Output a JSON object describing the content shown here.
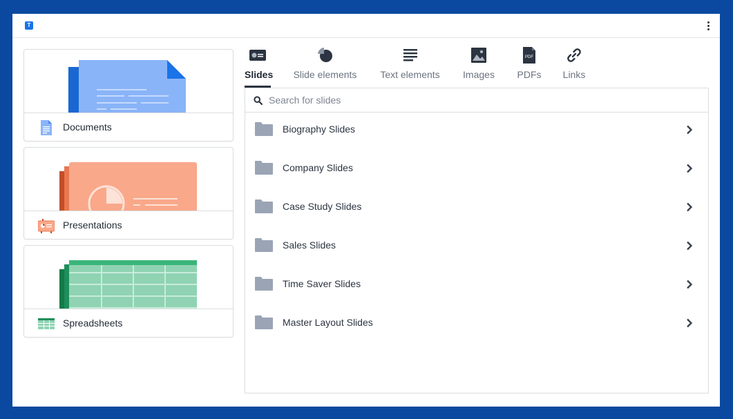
{
  "topbar": {
    "logo_letter": "T",
    "menu_icon": "more-vertical-icon"
  },
  "sidebar": {
    "cards": [
      {
        "label": "Documents",
        "icon": "docs-icon"
      },
      {
        "label": "Presentations",
        "icon": "slides-icon"
      },
      {
        "label": "Spreadsheets",
        "icon": "sheets-icon"
      }
    ]
  },
  "tabs": [
    {
      "label": "Slides",
      "icon": "slide-icon",
      "active": true
    },
    {
      "label": "Slide elements",
      "icon": "pie-chart-icon"
    },
    {
      "label": "Text elements",
      "icon": "text-lines-icon"
    },
    {
      "label": "Images",
      "icon": "image-icon"
    },
    {
      "label": "PDFs",
      "icon": "pdf-icon"
    },
    {
      "label": "Links",
      "icon": "link-icon"
    }
  ],
  "search": {
    "placeholder": "Search for slides",
    "value": ""
  },
  "folders": [
    {
      "label": "Biography Slides"
    },
    {
      "label": "Company Slides"
    },
    {
      "label": "Case Study Slides"
    },
    {
      "label": "Sales Slides"
    },
    {
      "label": "Time Saver Slides"
    },
    {
      "label": "Master Layout Slides"
    }
  ],
  "colors": {
    "background": "#0b49a0",
    "docs": "#8ab4f8",
    "docs_dark": "#1a73e8",
    "slides": "#f9a88a",
    "slides_dark": "#c1502a",
    "sheets": "#8fd3b3",
    "sheets_dark": "#1e8e5a",
    "folder": "#9aa4b5",
    "icon_dark": "#2b3440"
  }
}
